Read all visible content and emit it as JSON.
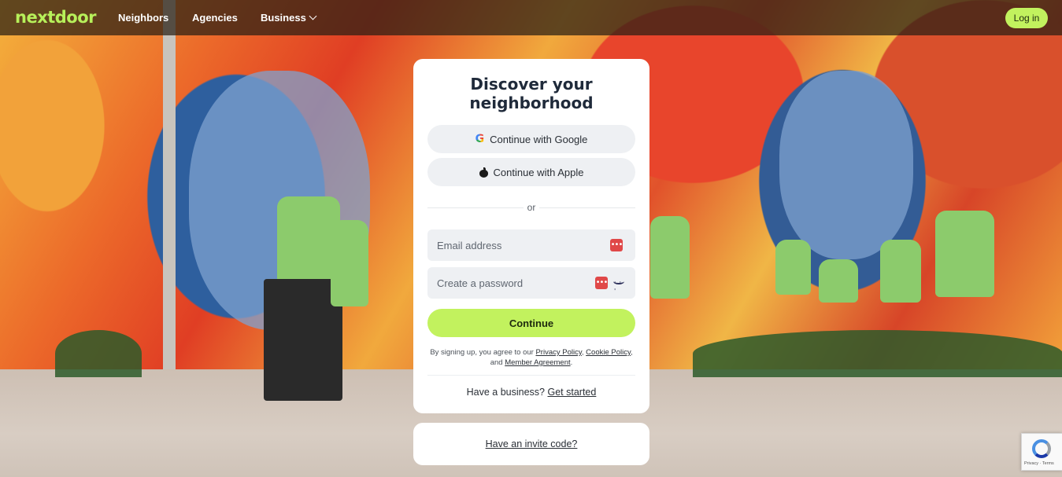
{
  "header": {
    "logo": "nextdoor",
    "nav": {
      "neighbors": "Neighbors",
      "agencies": "Agencies",
      "business": "Business"
    },
    "login_label": "Log in"
  },
  "card": {
    "title_line1": "Discover your",
    "title_line2": "neighborhood",
    "google_label": "Continue with Google",
    "apple_label": "Continue with Apple",
    "or_text": "or",
    "email_placeholder": "Email address",
    "password_placeholder": "Create a password",
    "password_manager_badge": "•••",
    "continue_label": "Continue",
    "legal": {
      "prefix": "By signing up, you agree to our",
      "privacy": "Privacy Policy",
      "sep": ",",
      "cookie": "Cookie Policy",
      "and": ", and",
      "member": "Member Agreement",
      "end": "."
    },
    "business_prompt": "Have a business?",
    "business_link": "Get started"
  },
  "invite": {
    "link": "Have an invite code?"
  },
  "recaptcha": {
    "text": "Privacy · Terms"
  },
  "colors": {
    "accent": "#c2f25e",
    "logo": "#b7f05a",
    "text": "#1f2a3a"
  }
}
